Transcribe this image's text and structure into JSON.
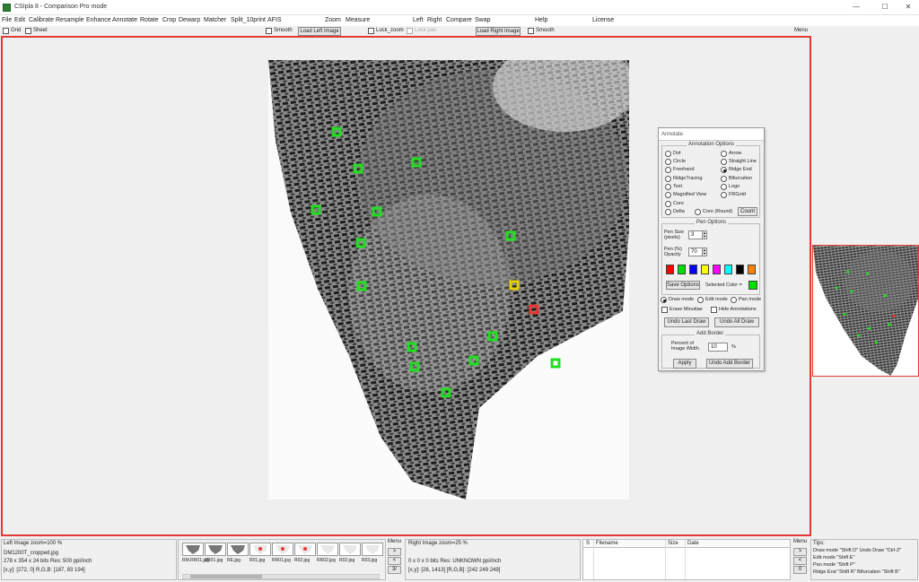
{
  "window": {
    "title": "CSIpla 8 - Comparison Pro mode",
    "minimize": "—",
    "maximize": "☐",
    "close": "✕"
  },
  "menu": [
    "File",
    "Edit",
    "Calibrate",
    "Resample",
    "Enhance",
    "Annotate",
    "Rotate",
    "Crop",
    "Dewarp",
    "Matcher",
    "Split_10print",
    "AFIS",
    "Zoom",
    "Measure",
    "Left",
    "Right",
    "Compare",
    "Swap",
    "Help",
    "License"
  ],
  "toolbar": {
    "grid": "Grid",
    "sheet": "Sheet",
    "smooth_left": "Smooth",
    "load_left": "Load Left Image",
    "lock_zoom": "Lock_zoom",
    "lock_pan": "Lock pan",
    "load_right": "Load Right Image",
    "smooth_right": "Smooth",
    "menu": "Menu"
  },
  "annotate": {
    "title": "Annotate",
    "options_title": "Annotation Options",
    "options": [
      {
        "label": "Dot"
      },
      {
        "label": "Arrow"
      },
      {
        "label": "Circle"
      },
      {
        "label": "Straight Line"
      },
      {
        "label": "Freehand"
      },
      {
        "label": "Ridge End",
        "selected": true
      },
      {
        "label": "RidgeTracing"
      },
      {
        "label": "Bifurcation"
      },
      {
        "label": "Text"
      },
      {
        "label": "Logo"
      },
      {
        "label": "Magnified View"
      },
      {
        "label": "FRGold"
      },
      {
        "label": "Core"
      },
      {
        "label": ""
      },
      {
        "label": "Delta"
      },
      {
        "label": "Core (Round)"
      }
    ],
    "count_button": "Count",
    "pen_title": "Pen Options",
    "pen_size_label": "Pen Size (pixels)",
    "pen_size": "3",
    "pen_opacity_label": "Pen (%) Opacity",
    "pen_opacity": "70",
    "swatches": [
      "#ff0000",
      "#00e000",
      "#0000ff",
      "#ffff00",
      "#ff00ff",
      "#00ffff",
      "#000000",
      "#ff8000"
    ],
    "save_options": "Save Options",
    "selected_color_label": "Selected Color =",
    "selected_color": "#00e000",
    "draw_mode": "Draw mode",
    "edit_mode": "Edit mode",
    "pan_mode": "Pan mode",
    "erase_minutiae": "Erase Minutiae",
    "hide_annotations": "Hide Annotations",
    "undo_last": "Undo Last Draw",
    "undo_all": "Undo All Draw",
    "border_title": "Add Border",
    "border_label": "Percent of Image Width",
    "border_value": "10",
    "border_unit": "%",
    "apply": "Apply",
    "undo_border": "Undo Add Border"
  },
  "bottom": {
    "left_image": "Left Image  zoom=100 %",
    "left_file": "DM1200T_cropped.jpg",
    "left_dims": "278 x 354 x 24 bits    Res: 500 ppi/inch",
    "left_coords": "[x,y]: [272, 0]   R,G,B: [187, 83 194]",
    "thumbs": [
      "RM.RR01.jpg",
      "ZR01.jpg",
      "RE.jpg",
      "R01.jpg",
      "RR01.jpg",
      "R02.jpg",
      "RR02.jpg",
      "R02.jpg",
      "R03.jpg"
    ],
    "menu": "Menu",
    "right_image": "Right Image  zoom=25 %",
    "right_dims": "0 x 0 x 0 bits    Res: UNKNOWN ppi/inch",
    "right_coords": "[x,y]: [28, 1413]   [R,G,B]: [242 249 249]",
    "table_headers": [
      "S",
      "Filename",
      "Size",
      "Date"
    ],
    "menu2": "Menu",
    "tips_title": "Tips:",
    "tips": [
      "Draw mode \"Shift D\"  Undo Draw \"Ctrl-Z\"",
      "Edit mode \"Shift E\"",
      "Pan mode \"Shift P\"",
      "Ridge End \"Shift R\"  Bifurcation \"Shift B\""
    ]
  },
  "colors": {
    "frame_border": "#e53935",
    "marker": "#22dd22"
  }
}
